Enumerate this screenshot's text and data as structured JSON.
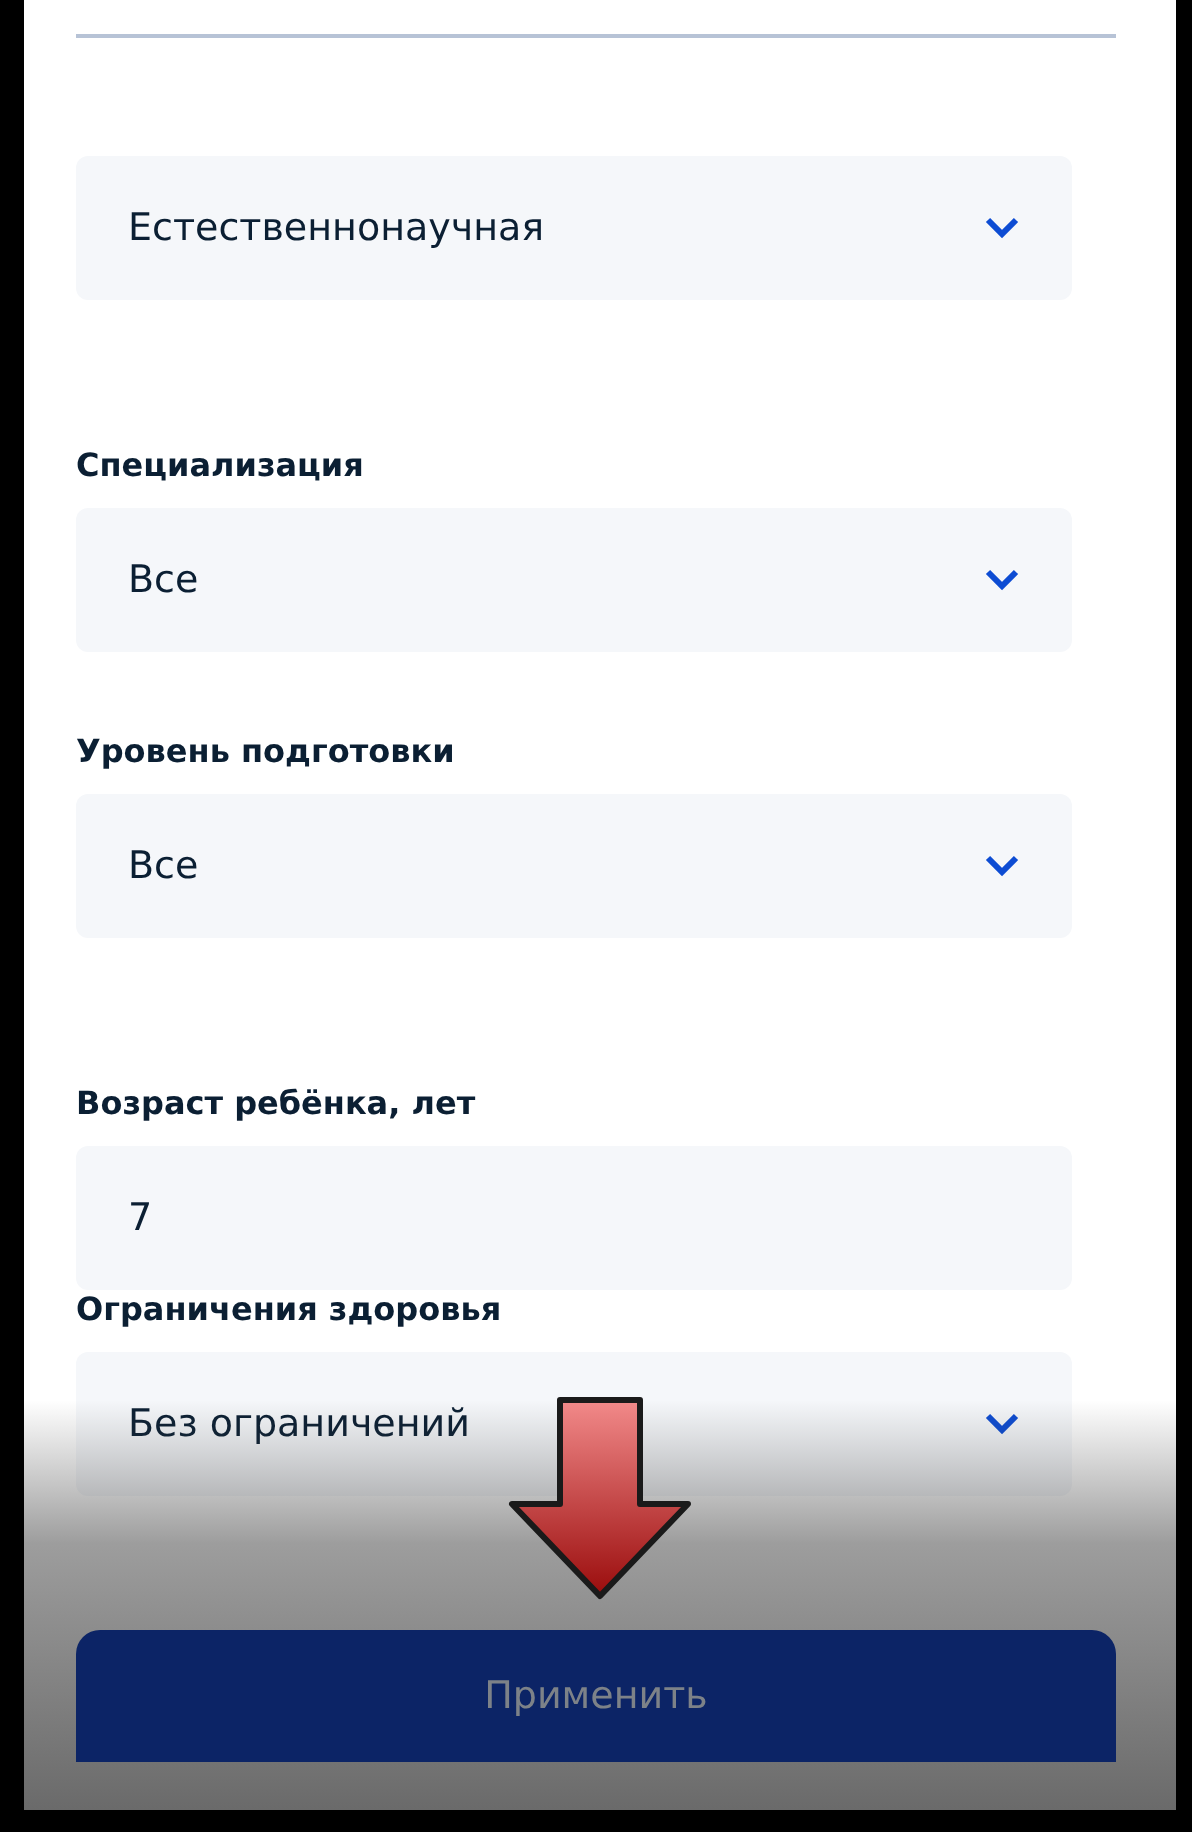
{
  "filters": [
    {
      "kind": "select",
      "value": "Естественнонаучная"
    },
    {
      "kind": "select",
      "label": "Специализация",
      "value": "Все"
    },
    {
      "kind": "select",
      "label": "Уровень подготовки",
      "value": "Все"
    },
    {
      "kind": "input",
      "label": "Возраст ребёнка, лет",
      "value": "7"
    },
    {
      "kind": "select",
      "label": "Ограничения здоровья",
      "value": "Без ограничений"
    }
  ],
  "apply_button": {
    "label": "Применить",
    "disabled": true
  }
}
